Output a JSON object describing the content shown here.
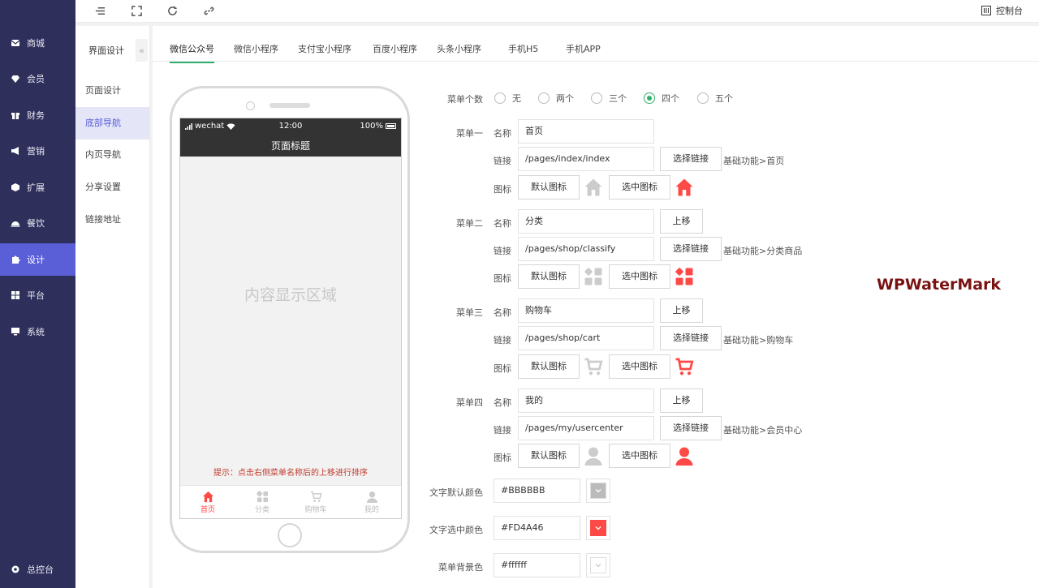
{
  "sidebar": {
    "items": [
      {
        "label": "商城",
        "icon": "mail-icon"
      },
      {
        "label": "会员",
        "icon": "diamond-icon"
      },
      {
        "label": "财务",
        "icon": "gift-icon"
      },
      {
        "label": "营销",
        "icon": "megaphone-icon"
      },
      {
        "label": "扩展",
        "icon": "cube-icon"
      },
      {
        "label": "餐饮",
        "icon": "cloche-icon"
      },
      {
        "label": "设计",
        "icon": "puzzle-icon"
      },
      {
        "label": "平台",
        "icon": "grid-icon"
      },
      {
        "label": "系统",
        "icon": "monitor-icon"
      }
    ],
    "active_index": 6,
    "footer_label": "总控台"
  },
  "topbar": {
    "console_label": "控制台"
  },
  "subside": {
    "title": "界面设计",
    "collapse_glyph": "«",
    "items": [
      "页面设计",
      "底部导航",
      "内页导航",
      "分享设置",
      "链接地址"
    ],
    "active_index": 1
  },
  "tabs": [
    "微信公众号",
    "微信小程序",
    "支付宝小程序",
    "百度小程序",
    "头条小程序",
    "手机H5",
    "手机APP"
  ],
  "active_tab": 0,
  "phone": {
    "carrier": "wechat",
    "time": "12:00",
    "battery": "100%",
    "page_title": "页面标题",
    "content_placeholder": "内容显示区域",
    "tip": "提示：点击右侧菜单名称后的上移进行排序",
    "tabbar": [
      "首页",
      "分类",
      "购物车",
      "我的"
    ]
  },
  "form": {
    "menu_count_label": "菜单个数",
    "menu_count_options": [
      "无",
      "两个",
      "三个",
      "四个",
      "五个"
    ],
    "menu_count_selected": "四个",
    "name_label": "名称",
    "link_label": "链接",
    "icon_label": "图标",
    "select_link_btn": "选择链接",
    "move_up_btn": "上移",
    "default_icon_btn": "默认图标",
    "selected_icon_btn": "选中图标",
    "menus": [
      {
        "label": "菜单一",
        "name": "首页",
        "link": "/pages/index/index",
        "path": "基础功能>首页",
        "icon": "home-icon"
      },
      {
        "label": "菜单二",
        "name": "分类",
        "link": "/pages/shop/classify",
        "path": "基础功能>分类商品",
        "icon": "category-icon"
      },
      {
        "label": "菜单三",
        "name": "购物车",
        "link": "/pages/shop/cart",
        "path": "基础功能>购物车",
        "icon": "cart-icon"
      },
      {
        "label": "菜单四",
        "name": "我的",
        "link": "/pages/my/usercenter",
        "path": "基础功能>会员中心",
        "icon": "user-icon"
      }
    ],
    "text_default_color_label": "文字默认颜色",
    "text_default_color": "#BBBBBB",
    "text_selected_color_label": "文字选中颜色",
    "text_selected_color": "#FD4A46",
    "menu_bg_color_label": "菜单背景色",
    "menu_bg_color": "#ffffff"
  },
  "colors": {
    "accent": "#5a5fd8",
    "sidebar": "#2e2f5b",
    "tab_active": "#2fb16b",
    "icon_default": "#cccccc",
    "icon_selected": "#fd4a46"
  },
  "watermark": "WPWaterMark"
}
